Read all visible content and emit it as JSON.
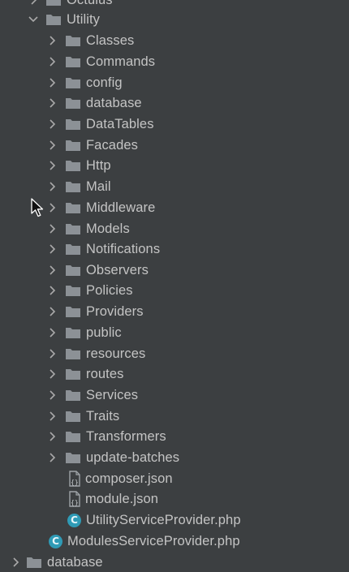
{
  "tree": {
    "top_partial": "Octulus",
    "utility": "Utility",
    "folders": [
      "Classes",
      "Commands",
      "config",
      "database",
      "DataTables",
      "Facades",
      "Http",
      "Mail",
      "Middleware",
      "Models",
      "Notifications",
      "Observers",
      "Policies",
      "Providers",
      "public",
      "resources",
      "routes",
      "Services",
      "Traits",
      "Transformers",
      "update-batches"
    ],
    "files": [
      "composer.json",
      "module.json"
    ],
    "class_file": "UtilityServiceProvider.php",
    "root_class_file": "ModulesServiceProvider.php",
    "bottom_partial": "database"
  }
}
